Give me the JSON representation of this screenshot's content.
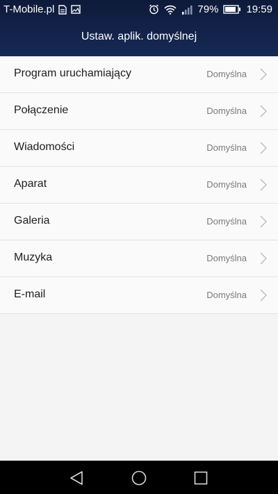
{
  "status_bar": {
    "carrier": "T-Mobile.pl",
    "battery_percent": "79%",
    "time": "19:59",
    "icons": [
      "sim-card-icon",
      "image-icon",
      "alarm-clock-icon",
      "wifi-icon",
      "signal-icon",
      "battery-icon"
    ]
  },
  "header": {
    "title": "Ustaw. aplik. domyślnej"
  },
  "settings": {
    "items": [
      {
        "label": "Program uruchamiający",
        "value": "Domyślna"
      },
      {
        "label": "Połączenie",
        "value": "Domyślna"
      },
      {
        "label": "Wiadomości",
        "value": "Domyślna"
      },
      {
        "label": "Aparat",
        "value": "Domyślna"
      },
      {
        "label": "Galeria",
        "value": "Domyślna"
      },
      {
        "label": "Muzyka",
        "value": "Domyślna"
      },
      {
        "label": "E-mail",
        "value": "Domyślna"
      }
    ]
  },
  "nav_bar": {
    "icons": [
      "back-icon",
      "home-icon",
      "recents-icon"
    ]
  },
  "colors": {
    "header_bg": "#13234a",
    "list_bg": "#fafafa",
    "nav_bg": "#000000"
  }
}
